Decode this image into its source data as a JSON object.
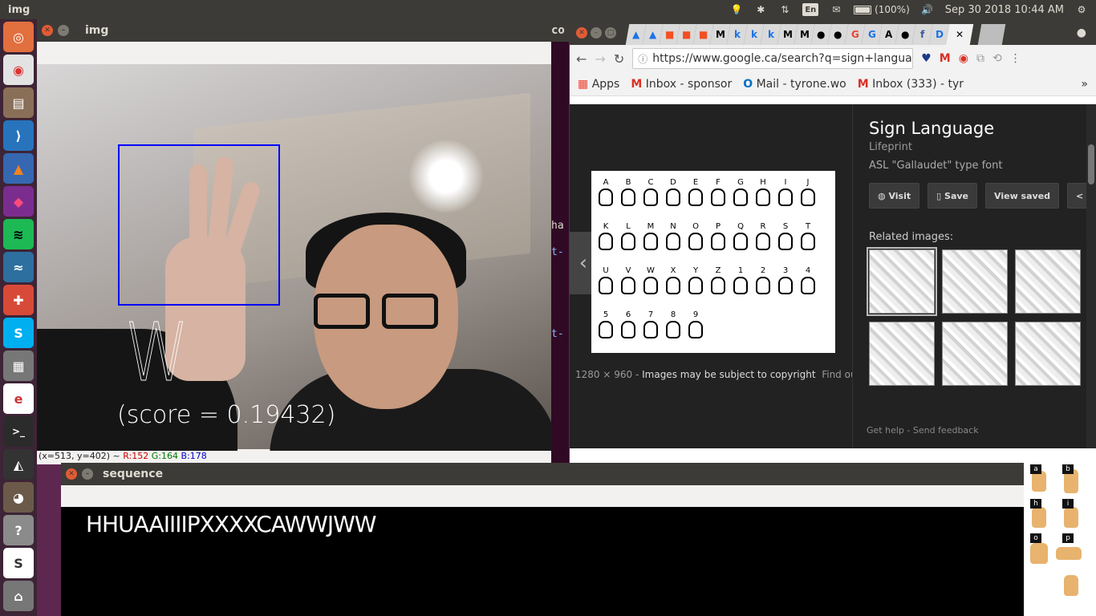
{
  "topbar": {
    "app_name": "img",
    "keyboard": "En",
    "battery": "(100%)",
    "datetime": "Sep 30 2018 10:44 AM"
  },
  "launcher": {
    "items": [
      "ubuntu-icon",
      "chrome-icon",
      "files-icon",
      "vscode-icon",
      "matlab-icon",
      "cube-icon",
      "spotify-icon",
      "mysql-icon",
      "settings-icon",
      "skype-icon",
      "calculator-icon",
      "eclipse-icon",
      "terminal-icon",
      "inkscape-icon",
      "gimp-icon",
      "help-icon",
      "slack-icon",
      "usb-icon"
    ]
  },
  "img_window": {
    "title": "img",
    "predicted_letter": "W",
    "score_text": "(score = 0.19432)",
    "status": {
      "coords": "(x=513, y=402) ~ ",
      "r": "R:152",
      "g": "G:164",
      "b": "B:178"
    },
    "bbox_color": "#0000ff"
  },
  "terminal_strip": {
    "title": "co",
    "lines": [
      "ha",
      "t-",
      "t-"
    ]
  },
  "chrome": {
    "url": "https://www.google.ca/search?q=sign+langua…",
    "bookmarks": {
      "apps": "Apps",
      "inbox_sponsor": "Inbox - sponsor",
      "mail_tyrone": "Mail - tyrone.wo",
      "inbox_333": "Inbox (333) - tyr"
    },
    "panel": {
      "title": "Sign Language",
      "source": "Lifeprint",
      "caption": "ASL \"Gallaudet\" type font",
      "buttons": {
        "visit": "Visit",
        "save": "Save",
        "view_saved": "View saved",
        "share": "Sh"
      },
      "related": "Related images:",
      "size": "1280 × 960",
      "copyright": "Images may be subject to copyright",
      "find_more": "Find out more",
      "get_help": "Get help",
      "send_feedback": "Send feedback"
    },
    "asl_letters": [
      "A",
      "B",
      "C",
      "D",
      "E",
      "F",
      "G",
      "H",
      "I",
      "J",
      "K",
      "L",
      "M",
      "N",
      "O",
      "P",
      "Q",
      "R",
      "S",
      "T",
      "U",
      "V",
      "W",
      "X",
      "Y",
      "Z",
      "1",
      "2",
      "3",
      "4",
      "5",
      "6",
      "7",
      "8",
      "9"
    ]
  },
  "sequence_window": {
    "title": "sequence",
    "text": "HHUAAIIIIPXXXXCAWWJWW"
  },
  "asl_ref_labels": [
    "a",
    "b",
    "h",
    "i",
    "o",
    "p"
  ]
}
